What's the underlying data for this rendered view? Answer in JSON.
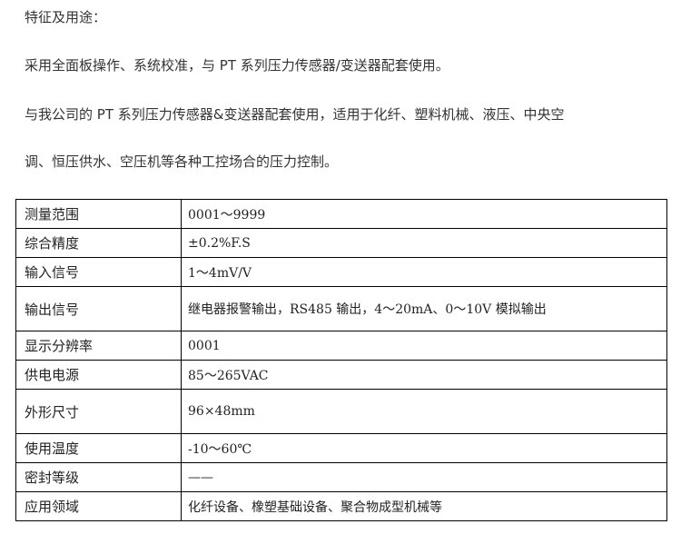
{
  "intro": {
    "heading": "特征及用途：",
    "line1": "采用全面板操作、系统校准，与 PT 系列压力传感器/变送器配套使用。",
    "line2": "与我公司的 PT 系列压力传感器&变送器配套使用，适用于化纤、塑料机械、液压、中央空",
    "line3": "调、恒压供水、空压机等各种工控场合的压力控制。"
  },
  "spec_table": {
    "rows": [
      {
        "label": "测量范围",
        "value": "0001～9999"
      },
      {
        "label": "综合精度",
        "value": "±0.2%F.S"
      },
      {
        "label": "输入信号",
        "value": "1～4mV/V"
      },
      {
        "label": "输出信号",
        "value": "继电器报警输出，RS485 输出，4～20mA、0～10V 模拟输出"
      },
      {
        "label": "显示分辨率",
        "value": "0001"
      },
      {
        "label": "供电电源",
        "value": "85～265VAC"
      },
      {
        "label": "外形尺寸",
        "value": "96×48mm"
      },
      {
        "label": "使用温度",
        "value": "-10～60℃"
      },
      {
        "label": "密封等级",
        "value": "——"
      },
      {
        "label": "应用领域",
        "value": "化纤设备、橡塑基础设备、聚合物成型机械等"
      }
    ]
  }
}
